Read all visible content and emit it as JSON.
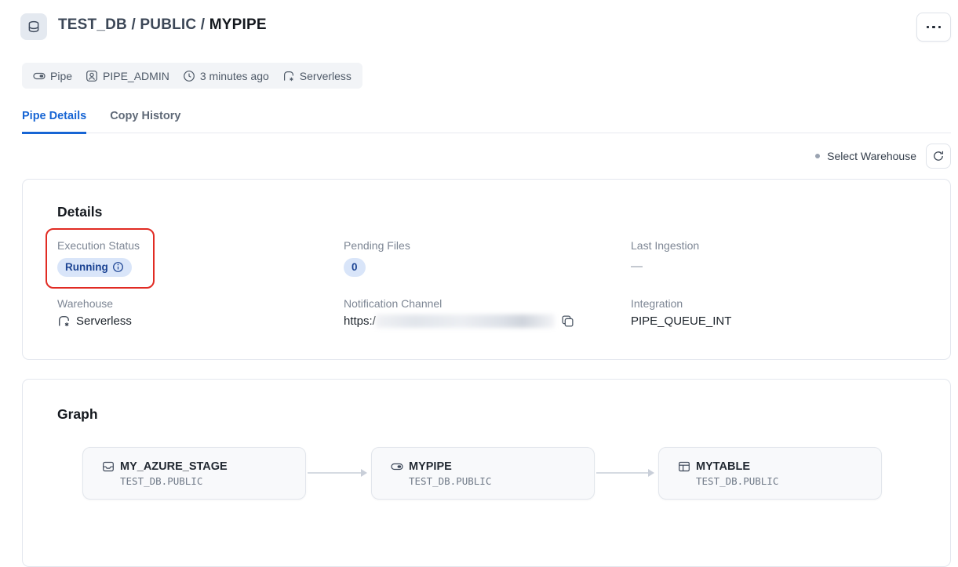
{
  "colors": {
    "accent_blue": "#1765d4",
    "badge_background": "#d9e5f9",
    "badge_text": "#1b4393",
    "annotation_red": "#e12b23",
    "label_gray": "#7d8694"
  },
  "icons": {
    "object": "database-icon",
    "more": "ellipsis-icon",
    "type": "pipe-icon",
    "owner": "user-role-icon",
    "updated": "clock-icon",
    "compute": "serverless-icon",
    "status_info": "info-icon",
    "copy": "copy-icon",
    "refresh": "refresh-icon",
    "stage_node": "stage-icon",
    "pipe_node": "pipe-icon",
    "table_node": "table-icon"
  },
  "header": {
    "breadcrumb": "TEST_DB / PUBLIC /",
    "object_name": "MYPIPE"
  },
  "meta_bar": {
    "type_label": "Pipe",
    "owner_label": "PIPE_ADMIN",
    "updated_label": "3 minutes ago",
    "compute_label": "Serverless"
  },
  "tabs": {
    "pipe_details": "Pipe Details",
    "copy_history": "Copy History"
  },
  "toolbar": {
    "select_warehouse": "Select Warehouse"
  },
  "details": {
    "heading": "Details",
    "execution_status": {
      "label": "Execution Status",
      "value": "Running"
    },
    "pending_files": {
      "label": "Pending Files",
      "value": "0"
    },
    "last_ingestion": {
      "label": "Last Ingestion",
      "value": "—"
    },
    "warehouse": {
      "label": "Warehouse",
      "value": "Serverless"
    },
    "notification_channel": {
      "label": "Notification Channel",
      "value_visible": "https:/"
    },
    "integration": {
      "label": "Integration",
      "value": "PIPE_QUEUE_INT"
    }
  },
  "graph": {
    "heading": "Graph",
    "nodes": [
      {
        "name": "MY_AZURE_STAGE",
        "qualifier": "TEST_DB.PUBLIC"
      },
      {
        "name": "MYPIPE",
        "qualifier": "TEST_DB.PUBLIC"
      },
      {
        "name": "MYTABLE",
        "qualifier": "TEST_DB.PUBLIC"
      }
    ]
  }
}
